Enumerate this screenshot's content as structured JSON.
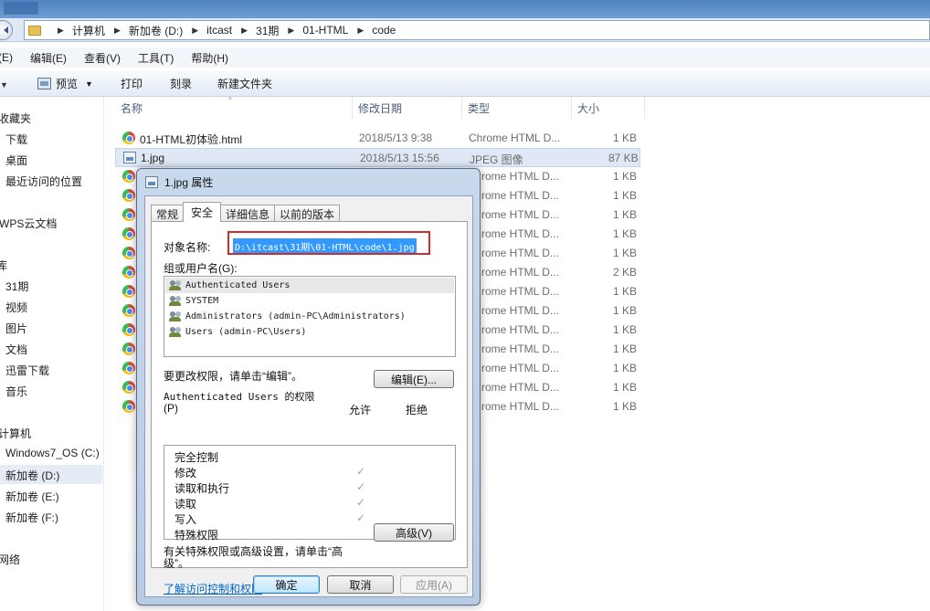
{
  "address": {
    "crumbs": [
      "计算机",
      "新加卷 (D:)",
      "itcast",
      "31期",
      "01-HTML",
      "code"
    ]
  },
  "menu": [
    "(E)",
    "编辑(E)",
    "查看(V)",
    "工具(T)",
    "帮助(H)"
  ],
  "toolbar": {
    "preview": "预览",
    "print": "打印",
    "burn": "刻录",
    "new_folder": "新建文件夹"
  },
  "sidebar": {
    "items": [
      "收藏夹",
      "下载",
      "桌面",
      "最近访问的位置",
      "WPS云文档",
      "库",
      "31期",
      "视频",
      "图片",
      "文档",
      "迅雷下载",
      "音乐",
      "计算机",
      "Windows7_OS (C:)",
      "新加卷 (D:)",
      "新加卷 (E:)",
      "新加卷 (F:)",
      "网络"
    ]
  },
  "list": {
    "columns": {
      "name": "名称",
      "date": "修改日期",
      "type": "类型",
      "size": "大小"
    },
    "rows": [
      {
        "name": "01-HTML初体验.html",
        "date": "2018/5/13 9:38",
        "type": "Chrome HTML D...",
        "size": "1 KB",
        "icon": "chrome-icon"
      },
      {
        "name": "1.jpg",
        "date": "2018/5/13 15:56",
        "type": "JPEG 图像",
        "size": "87 KB",
        "icon": "image-icon"
      }
    ],
    "partial_rows": [
      {
        "type": "rome HTML D...",
        "size": "1 KB"
      },
      {
        "type": "rome HTML D...",
        "size": "1 KB"
      },
      {
        "type": "rome HTML D...",
        "size": "1 KB"
      },
      {
        "type": "rome HTML D...",
        "size": "1 KB"
      },
      {
        "type": "rome HTML D...",
        "size": "1 KB"
      },
      {
        "type": "rome HTML D...",
        "size": "2 KB"
      },
      {
        "type": "rome HTML D...",
        "size": "1 KB"
      },
      {
        "type": "rome HTML D...",
        "size": "1 KB"
      },
      {
        "type": "rome HTML D...",
        "size": "1 KB"
      },
      {
        "type": "rome HTML D...",
        "size": "1 KB"
      },
      {
        "type": "rome HTML D...",
        "size": "1 KB"
      },
      {
        "type": "rome HTML D...",
        "size": "1 KB"
      },
      {
        "type": "rome HTML D...",
        "size": "1 KB"
      }
    ]
  },
  "dialog": {
    "title": "1.jpg 属性",
    "tabs": [
      "常规",
      "安全",
      "详细信息",
      "以前的版本"
    ],
    "active_tab": "安全",
    "object_label": "对象名称:",
    "object_path": "D:\\itcast\\31期\\01-HTML\\code\\1.jpg",
    "groups_label": "组或用户名(G):",
    "users": [
      "Authenticated Users",
      "SYSTEM",
      "Administrators (admin-PC\\Administrators)",
      "Users (admin-PC\\Users)"
    ],
    "change_text": "要更改权限，请单击“编辑”。",
    "edit_button": "编辑(E)...",
    "perm_header": "Authenticated Users 的权限",
    "perm_p": "(P)",
    "allow": "允许",
    "deny": "拒绝",
    "permissions": [
      {
        "name": "完全控制",
        "allow": false
      },
      {
        "name": "修改",
        "allow": true
      },
      {
        "name": "读取和执行",
        "allow": true
      },
      {
        "name": "读取",
        "allow": true
      },
      {
        "name": "写入",
        "allow": true
      },
      {
        "name": "特殊权限",
        "allow": false
      }
    ],
    "check_mark": "✓",
    "special_text": "有关特殊权限或高级设置，请单击“高级”。",
    "advanced_button": "高级(V)",
    "learn_link": "了解访问控制和权限",
    "ok": "确定",
    "cancel": "取消",
    "apply": "应用(A)"
  }
}
